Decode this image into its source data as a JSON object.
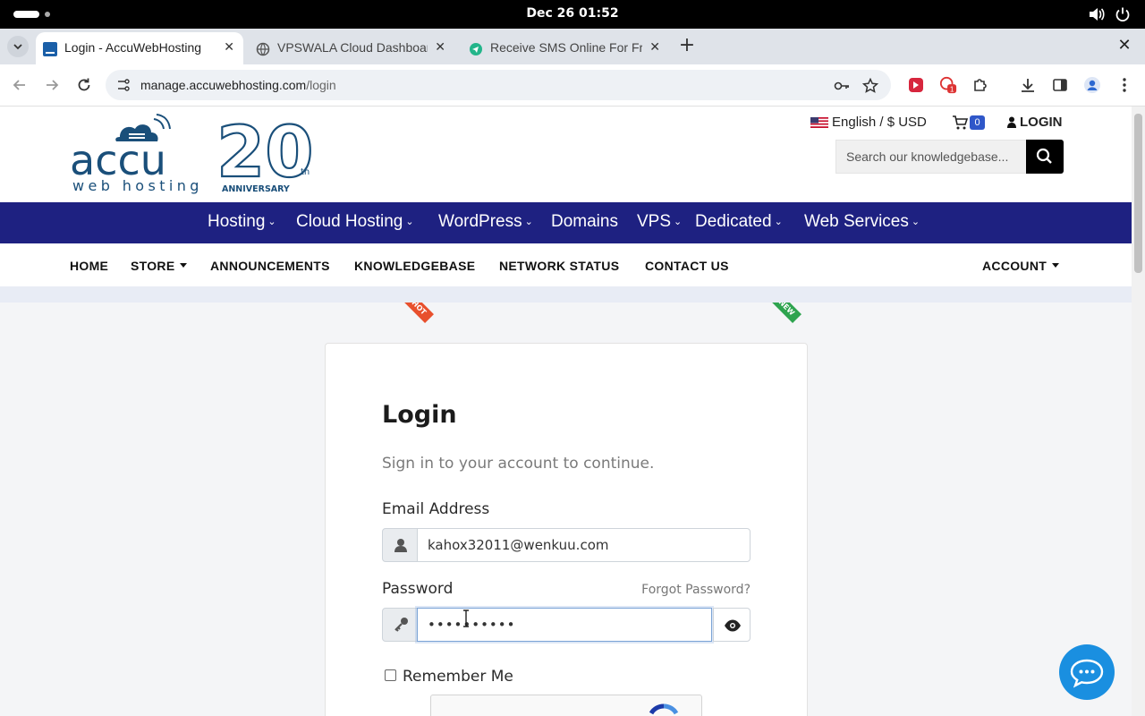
{
  "os": {
    "clock": "Dec 26  01:52"
  },
  "tabs": [
    {
      "title": "Login - AccuWebHosting",
      "active": true
    },
    {
      "title": "VPSWALA Cloud Dashboard",
      "active": false
    },
    {
      "title": "Receive SMS Online For Free",
      "active": false
    }
  ],
  "address": {
    "host": "manage.accuwebhosting.com",
    "path": "/login"
  },
  "header": {
    "logo_text": "accu",
    "logo_sub": "web hosting",
    "logo_badge": "20",
    "logo_th": "th",
    "logo_anniv": "ANNIVERSARY",
    "language": "English / $ USD",
    "cart_count": "0",
    "login": "LOGIN",
    "search_placeholder": "Search our knowledgebase..."
  },
  "mainnav": {
    "items": [
      "Hosting",
      "Cloud Hosting",
      "WordPress",
      "Domains",
      "VPS",
      "Dedicated",
      "Web Services"
    ],
    "chevron": "⌄",
    "hot_label": "HOT",
    "new_label": "NEW"
  },
  "subnav": {
    "items": [
      "HOME",
      "STORE",
      "ANNOUNCEMENTS",
      "KNOWLEDGEBASE",
      "NETWORK STATUS",
      "CONTACT US"
    ],
    "account": "ACCOUNT"
  },
  "login": {
    "title": "Login",
    "subtitle": "Sign in to your account to continue.",
    "email_label": "Email Address",
    "email_value": "kahox32011@wenkuu.com",
    "password_label": "Password",
    "forgot": "Forgot Password?",
    "password_value": "••••••••••",
    "remember": "Remember Me"
  },
  "colors": {
    "nav_bg": "#1e2181",
    "brand": "#1a4f7a",
    "accent": "#1a8fe0",
    "hot": "#e8502d",
    "new": "#2ea44f"
  }
}
